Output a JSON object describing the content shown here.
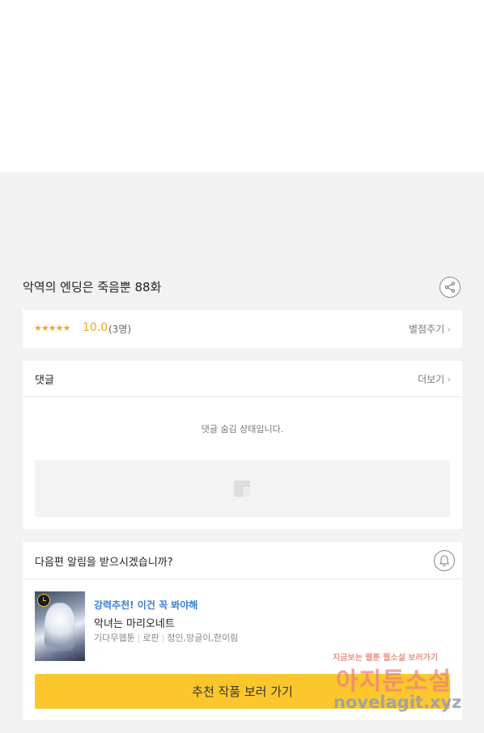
{
  "episode": {
    "title": "악역의 엔딩은 죽음뿐 88화"
  },
  "rating": {
    "stars": "★★★★★",
    "score": "10.0",
    "count": "(3명)",
    "rate_link": "별점주기"
  },
  "comments": {
    "title": "댓글",
    "more_link": "더보기",
    "hidden_message": "댓글 숨김 상태입니다."
  },
  "notify": {
    "question": "다음편 알림을 받으시겠습니까?"
  },
  "recommendation": {
    "tag": "강력추천! 이건 꼭 봐야해",
    "title": "악녀는 마리오네트",
    "meta": [
      "기다무웹툰",
      "로판",
      "정인,망글이,한이림"
    ],
    "cta": "추천 작품 보러 가기"
  },
  "watermark": {
    "top": "지금보는 웹툰 웹소설 보러가기",
    "middle": "아지툰소설",
    "bottom": "novelagit.xyz"
  },
  "colors": {
    "accent_yellow": "#fcc62d",
    "star_orange": "#f5a623",
    "tag_blue": "#3b7fd4"
  }
}
